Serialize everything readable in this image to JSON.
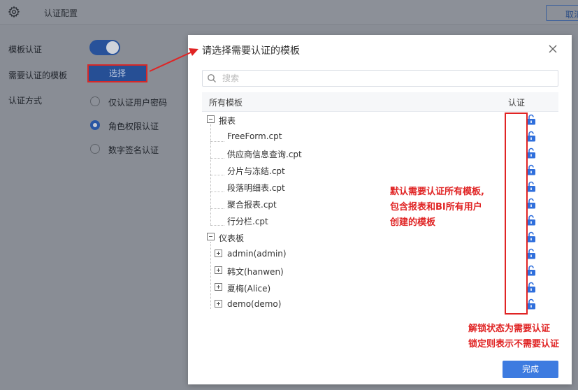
{
  "background": {
    "title": "认证配置",
    "cancel_label": "取消",
    "template_auth_label": "模板认证",
    "template_auth_enabled": true,
    "templates_label": "需要认证的模板",
    "select_button_label": "选择",
    "auth_method_label": "认证方式",
    "auth_methods": [
      {
        "label": "仅认证用户密码",
        "checked": false
      },
      {
        "label": "角色权限认证",
        "checked": true
      },
      {
        "label": "数字签名认证",
        "checked": false
      }
    ]
  },
  "dialog": {
    "title": "请选择需要认证的模板",
    "search_placeholder": "搜索",
    "col_name": "所有模板",
    "col_auth": "认证",
    "confirm_label": "完成"
  },
  "tree": {
    "groups": [
      {
        "label": "报表",
        "expanded": true,
        "children": [
          "FreeForm.cpt",
          "供应商信息查询.cpt",
          "分片与冻结.cpt",
          "段落明细表.cpt",
          "聚合报表.cpt",
          "行分栏.cpt"
        ]
      },
      {
        "label": "仪表板",
        "expanded": true,
        "children": [
          "admin(admin)",
          "韩文(hanwen)",
          "夏梅(Alice)",
          "demo(demo)"
        ]
      }
    ],
    "lock_state": "unlocked"
  },
  "annotations": {
    "note1_line1": "默认需要认证所有模板,",
    "note1_line2": "包含报表和BI所有用户",
    "note1_line3": "创建的模板",
    "note2_line1": "解锁状态为需要认证",
    "note2_line2": "锁定则表示不需要认证"
  },
  "colors": {
    "accent": "#3d7be0",
    "annotation": "#e02424",
    "lock": "#2f6fdc"
  }
}
